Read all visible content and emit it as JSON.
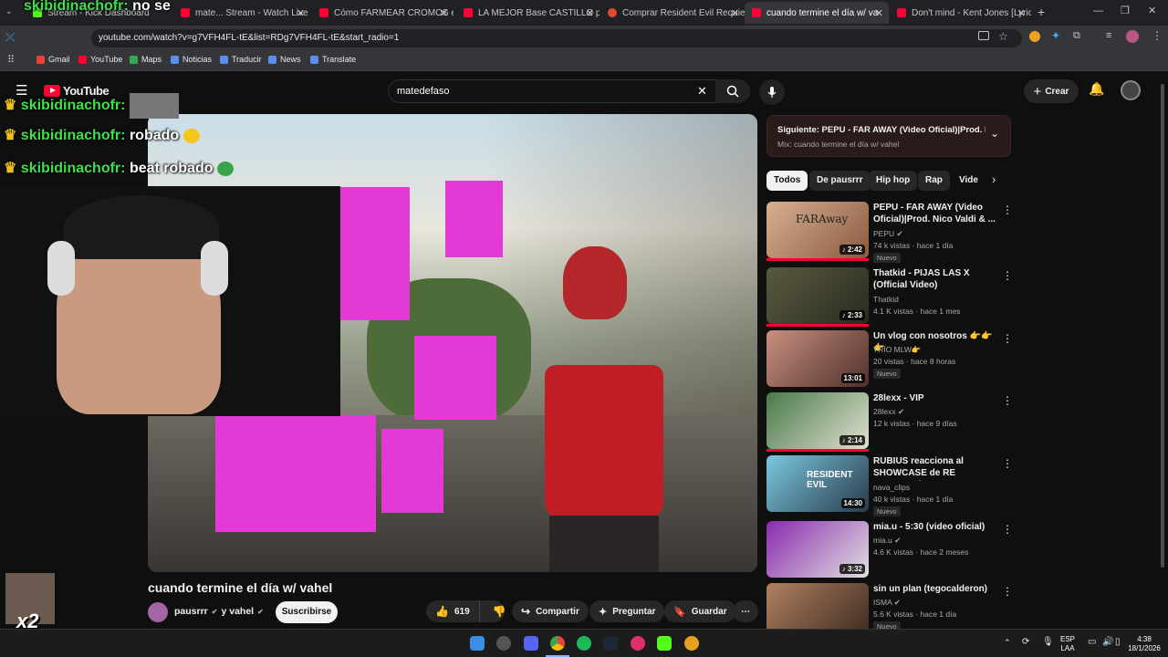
{
  "browser": {
    "tabs": [
      {
        "label": "Stream - Kick Dashboard"
      },
      {
        "label": "mate... Stream - Watch Live"
      },
      {
        "label": "Cómo FARMEAR CROMOS en"
      },
      {
        "label": "LA MEJOR Base CASTILLO para"
      },
      {
        "label": "Comprar Resident Evil Requiem"
      },
      {
        "label": "cuando termine el día w/ va"
      },
      {
        "label": "Don't mind - Kent Jones [Lyrics"
      }
    ],
    "new_tab": "+",
    "url": "youtube.com/watch?v=g7VFH4FL-tE&list=RDg7VFH4FL-tE&start_radio=1",
    "bookmarks": [
      "Gmail",
      "YouTube",
      "Maps",
      "Noticias",
      "Traducir",
      "News",
      "Translate"
    ]
  },
  "youtube": {
    "logo": "YouTube",
    "search_value": "matedefaso",
    "create_label": "Crear"
  },
  "overlay": {
    "top_text_user": "skibidinachofr:",
    "top_text_msg": "no se",
    "chat": [
      {
        "user": "skibidinachofr:",
        "msg": ""
      },
      {
        "user": "skibidinachofr:",
        "msg": "robado"
      },
      {
        "user": "skibidinachofr:",
        "msg": "beat robado"
      }
    ],
    "multiplier": "x2"
  },
  "video": {
    "title": "cuando termine el día w/ vahel",
    "channel": "pausrrr",
    "and_channel": "y vahel",
    "subscribe_label": "Suscribirse",
    "likes": "619",
    "share_label": "Compartir",
    "ask_label": "Preguntar",
    "save_label": "Guardar"
  },
  "next_up": {
    "title": "Siguiente: PEPU - FAR AWAY (Video Oficial)|Prod. N...",
    "subtitle": "Mix: cuando termine el día w/ vahel"
  },
  "chips": [
    "Todos",
    "De pausrrr",
    "Hip hop",
    "Rap",
    "Vide"
  ],
  "recommendations": [
    {
      "title": "PEPU - FAR AWAY (Video Oficial)|Prod. Nico Valdi & ...",
      "channel": "PEPU",
      "meta": "74 k vistas · hace 1 día",
      "badge": "Nuevo",
      "duration": "2:42",
      "thumb_text": "FARAway"
    },
    {
      "title": "Thatkid - PIJAS LAS X (Official Video)",
      "channel": "Thatkid",
      "meta": "4.1 K vistas · hace 1 mes",
      "badge": "",
      "duration": "2:33",
      "thumb_text": ""
    },
    {
      "title": "Un vlog con nosotros 👉👉👉",
      "channel": "TRÍO MLW👉",
      "meta": "20 vistas · hace 8 horas",
      "badge": "Nuevo",
      "duration": "13:01",
      "thumb_text": ""
    },
    {
      "title": "28lexx - VIP",
      "channel": "28lexx",
      "meta": "12 k vistas · hace 9 días",
      "badge": "",
      "duration": "2:14",
      "thumb_text": ""
    },
    {
      "title": "RUBIUS reacciona al SHOWCASE de RE REQUIEM | ...",
      "channel": "nava_clips",
      "meta": "40 k vistas · hace 1 día",
      "badge": "Nuevo",
      "duration": "14:30",
      "thumb_text": "RESIDENT EVIL"
    },
    {
      "title": "mia.u - 5:30 (video oficial)",
      "channel": "mia.u",
      "meta": "4.6 K vistas · hace 2 meses",
      "badge": "",
      "duration": "3:32",
      "thumb_text": ""
    },
    {
      "title": "sin un plan (tegocalderon)",
      "channel": "ISMA",
      "meta": "5.6 K vistas · hace 1 día",
      "badge": "Nuevo",
      "duration": "",
      "thumb_text": ""
    }
  ],
  "taskbar": {
    "lang_top": "ESP",
    "lang_bottom": "LAA",
    "time": "4:38",
    "date": "18/1/2026"
  }
}
